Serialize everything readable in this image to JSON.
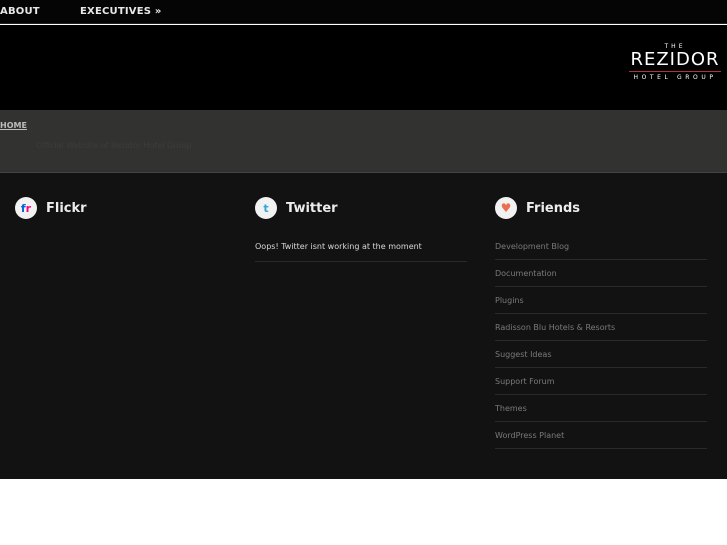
{
  "nav": {
    "items": [
      {
        "label": "ABOUT"
      },
      {
        "label": "EXECUTIVES »"
      }
    ]
  },
  "logo": {
    "the": "THE",
    "name": "REZIDOR",
    "group": "HOTEL GROUP"
  },
  "breadcrumb": {
    "home": "HOME",
    "subtitle": "Official Website of Rezidor Hotel Group"
  },
  "footer": {
    "flickr": {
      "title": "Flickr",
      "icon": "flickr-icon"
    },
    "twitter": {
      "title": "Twitter",
      "icon": "twitter-icon",
      "message": "Oops! Twitter isnt working at the moment"
    },
    "friends": {
      "title": "Friends",
      "icon": "heart-icon",
      "links": [
        {
          "label": "Development Blog"
        },
        {
          "label": "Documentation"
        },
        {
          "label": "Plugins"
        },
        {
          "label": "Radisson Blu Hotels & Resorts"
        },
        {
          "label": "Suggest Ideas"
        },
        {
          "label": "Support Forum"
        },
        {
          "label": "Themes"
        },
        {
          "label": "WordPress Planet"
        }
      ]
    }
  },
  "colors": {
    "flickr_blue": "#0063dc",
    "flickr_pink": "#ff0084",
    "twitter_blue": "#33a5d6",
    "heart": "#e8704f",
    "logo_rule": "#b0323b"
  }
}
